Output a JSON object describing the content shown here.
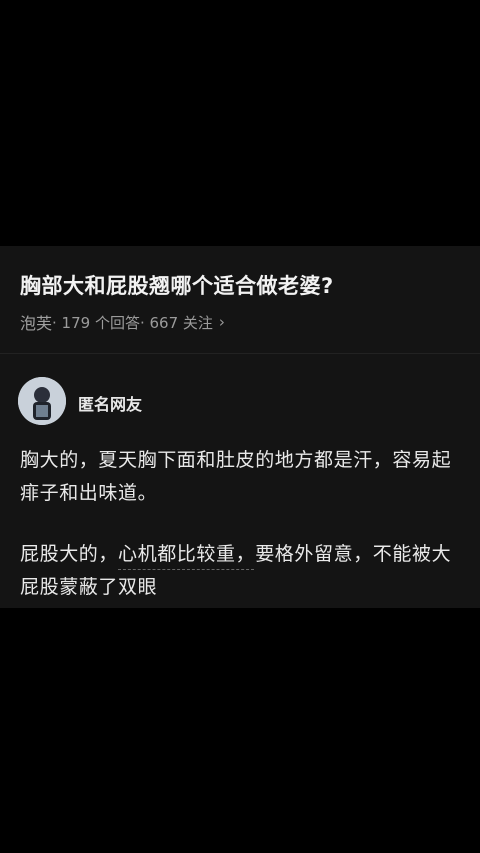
{
  "question": {
    "title": "胸部大和屁股翘哪个适合做老婆?",
    "author": "泡芙",
    "answers": "· 179 个回答",
    "followers": "· 667 关注"
  },
  "answer": {
    "username": "匿名网友",
    "paragraph1": "胸大的，夏天胸下面和肚皮的地方都是汗，容易起痱子和出味道。",
    "paragraph2": "屁股大的，心机都比较重，要格外留意，不能被大屁股蒙蔽了双眼"
  },
  "icons": {
    "chevron": "chevron-right-icon"
  },
  "colors": {
    "background": "#000000",
    "card": "#141414",
    "text": "#e9e9e9",
    "meta": "#9b9b9b"
  }
}
